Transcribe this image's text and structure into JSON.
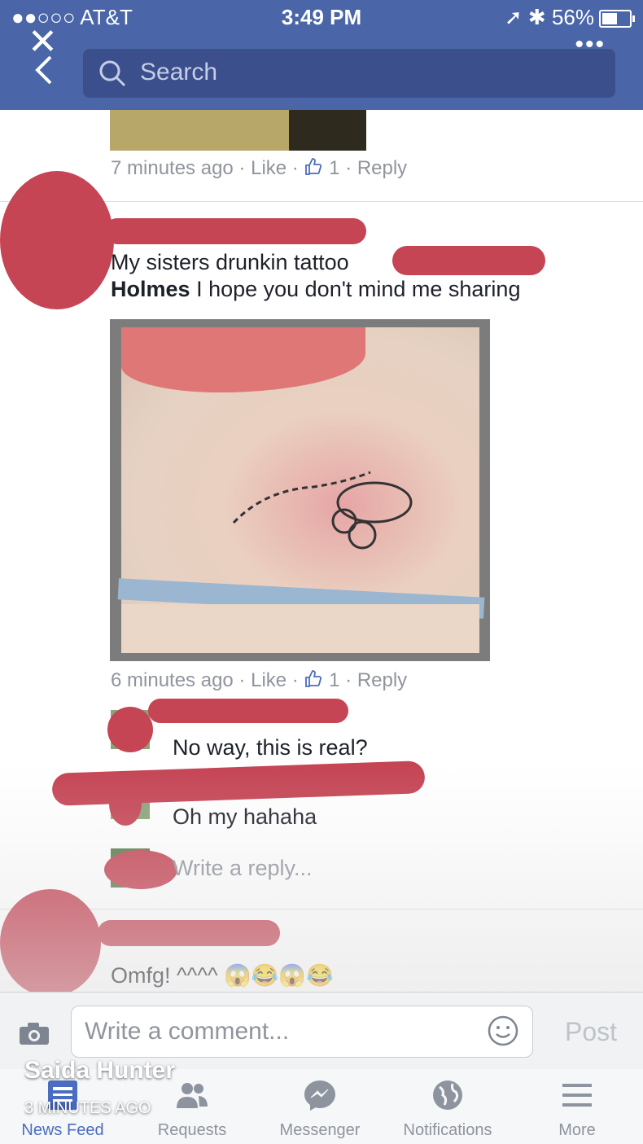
{
  "status_bar": {
    "carrier": "●●○○○ AT&T",
    "time": "3:49 PM",
    "battery": "56%"
  },
  "header": {
    "search_placeholder": "Search"
  },
  "comments": [
    {
      "meta": {
        "time": "7 minutes ago",
        "like": "Like",
        "like_count": "1",
        "reply": "Reply"
      }
    },
    {
      "text_line1": "My sisters drunkin tattoo",
      "name_tag": "Holmes",
      "text_line2": "I hope you don't mind me sharing",
      "meta": {
        "time": "6 minutes ago",
        "like": "Like",
        "like_count": "1",
        "reply": "Reply"
      },
      "replies": [
        {
          "text": "No way, this is real?"
        },
        {
          "text": "Oh my hahaha"
        }
      ],
      "reply_placeholder": "Write a reply..."
    },
    {
      "text": "Omfg! ^^^^ 😱😂😱😂"
    }
  ],
  "composer": {
    "placeholder": "Write a comment...",
    "post_label": "Post"
  },
  "story_overlay": {
    "name": "Saida Hunter",
    "time": "3 MINUTES AGO"
  },
  "tabs": [
    {
      "label": "News Feed",
      "icon": "news-feed-icon",
      "active": true
    },
    {
      "label": "Requests",
      "icon": "friends-icon",
      "active": false
    },
    {
      "label": "Messenger",
      "icon": "messenger-icon",
      "active": false
    },
    {
      "label": "Notifications",
      "icon": "globe-icon",
      "active": false
    },
    {
      "label": "More",
      "icon": "menu-icon",
      "active": false
    }
  ],
  "colors": {
    "header_blue": "#4a66a8",
    "redaction": "#c54555",
    "accent": "#4b6cc1"
  }
}
